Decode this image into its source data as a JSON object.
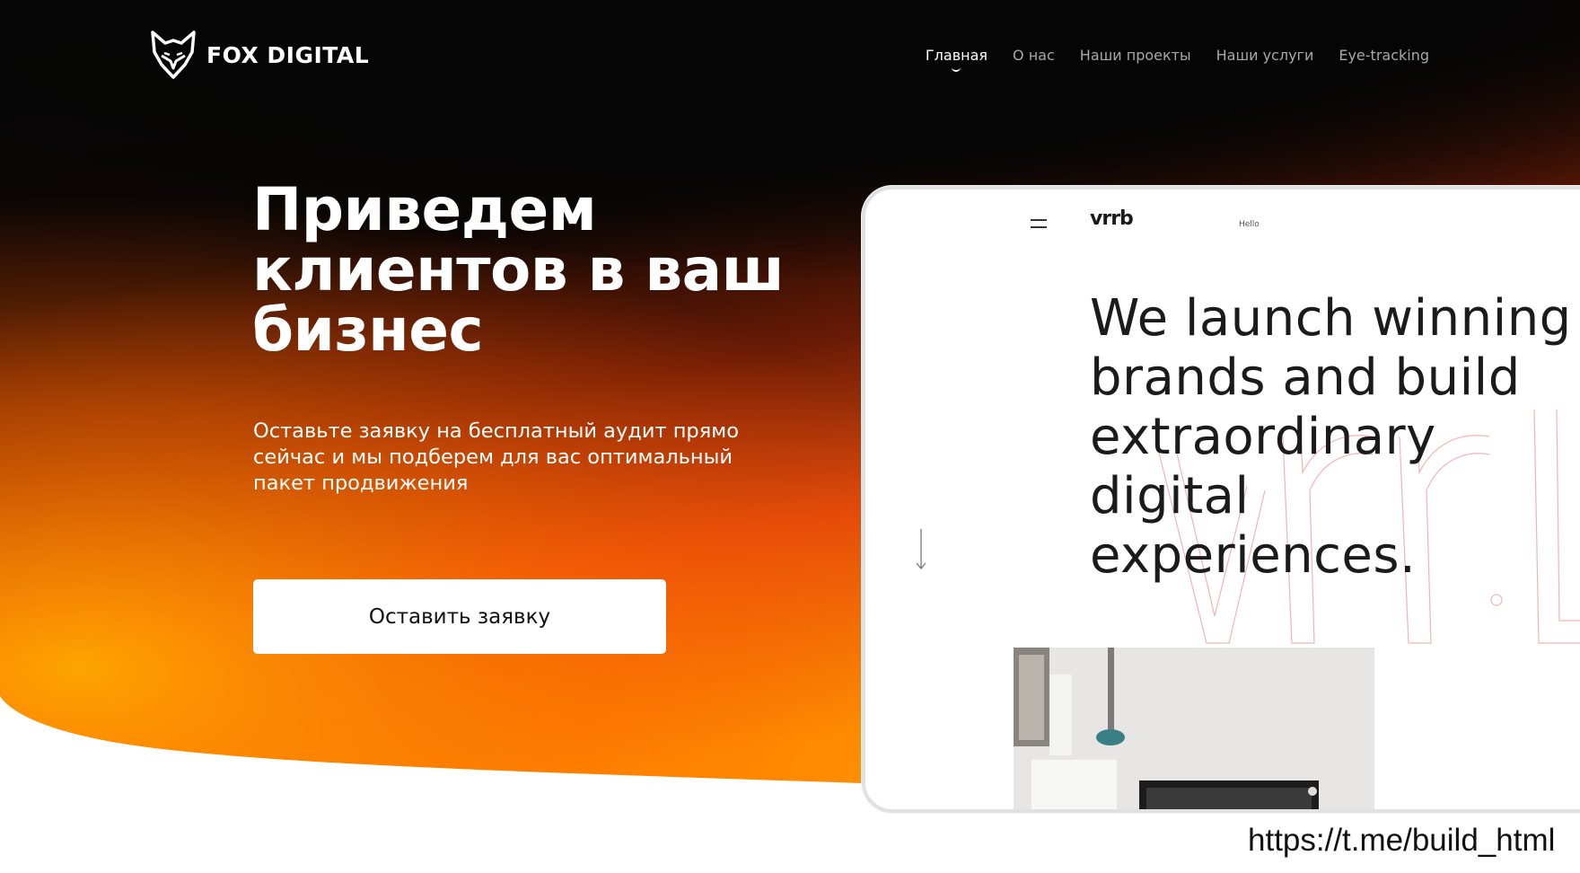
{
  "header": {
    "logo_text": "FOX DIGITAL",
    "logo_icon": "fox-head-icon",
    "nav": [
      {
        "label": "Главная",
        "active": true
      },
      {
        "label": "О нас",
        "active": false
      },
      {
        "label": "Наши проекты",
        "active": false
      },
      {
        "label": "Наши услуги",
        "active": false
      },
      {
        "label": "Eye-tracking",
        "active": false
      }
    ]
  },
  "hero": {
    "title_lines": [
      "Приведем",
      "клиентов в ваш",
      "бизнес"
    ],
    "subtitle": "Оставьте заявку на бесплатный аудит прямо сейчас и мы подберем для вас оптимальный пакет продвижения",
    "cta_label": "Оставить заявку"
  },
  "mockup": {
    "brand": "vrrb",
    "hello": "Hello",
    "headline_lines": [
      "We launch winning",
      "brands and build",
      "extraordinary",
      "digital",
      "experiences."
    ],
    "menu_icon": "hamburger-icon",
    "arrow_icon": "down-arrow-icon"
  },
  "footer": {
    "url": "https://t.me/build_html"
  },
  "colors": {
    "background_dark": "#080808",
    "orange_deep": "#e0420a",
    "orange_bright": "#ff8c00",
    "white": "#ffffff"
  }
}
